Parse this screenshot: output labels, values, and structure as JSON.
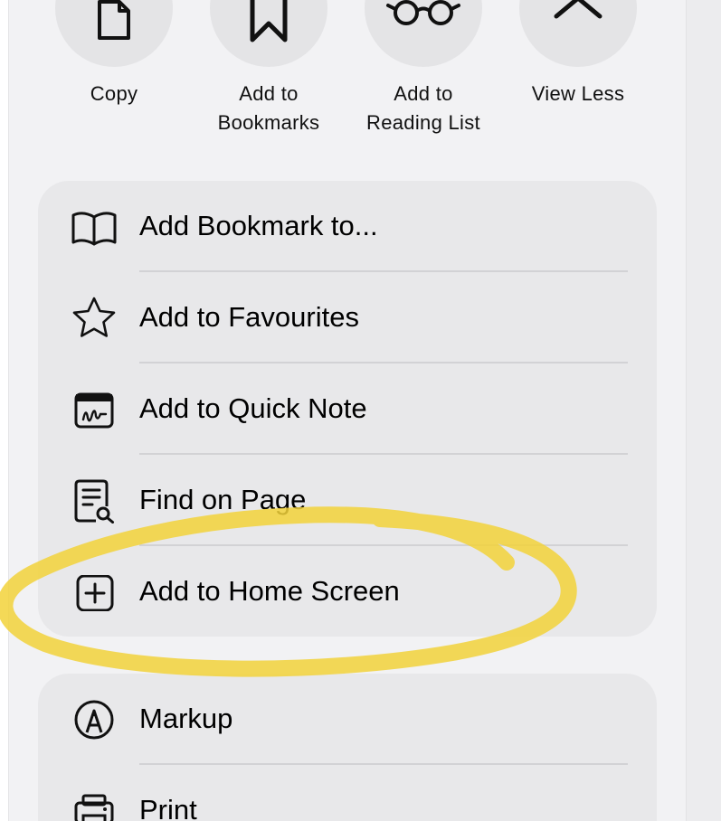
{
  "actions": [
    {
      "label": "Copy",
      "icon": "copy-icon"
    },
    {
      "label": "Add to\nBookmarks",
      "icon": "bookmark-icon"
    },
    {
      "label": "Add to\nReading List",
      "icon": "glasses-icon"
    },
    {
      "label": "View Less",
      "icon": "chevron-up-icon"
    }
  ],
  "menu_primary": [
    {
      "label": "Add Bookmark to...",
      "icon": "book-icon"
    },
    {
      "label": "Add to Favourites",
      "icon": "star-icon"
    },
    {
      "label": "Add to Quick Note",
      "icon": "quick-note-icon"
    },
    {
      "label": "Find on Page",
      "icon": "find-on-page-icon"
    },
    {
      "label": "Add to Home Screen",
      "icon": "add-square-icon"
    }
  ],
  "menu_secondary": [
    {
      "label": "Markup",
      "icon": "markup-pen-icon"
    },
    {
      "label": "Print",
      "icon": "printer-icon"
    }
  ],
  "colors": {
    "sheet_background": "#f2f2f4",
    "group_background": "#e8e8ea",
    "highlight_marker": "#f2d23a"
  }
}
